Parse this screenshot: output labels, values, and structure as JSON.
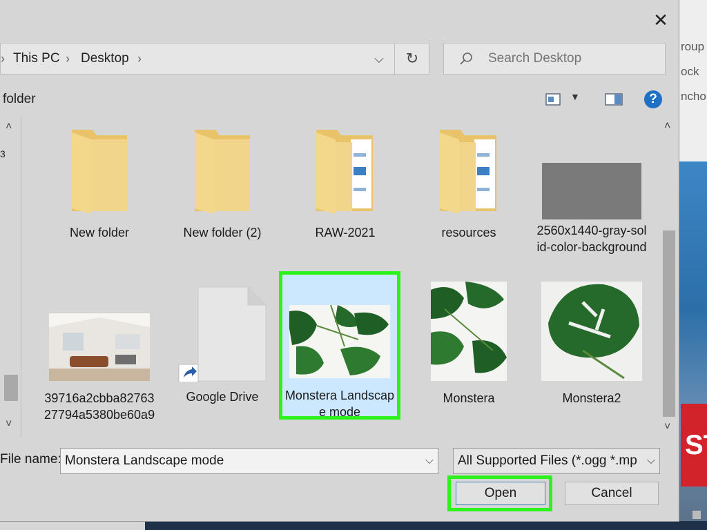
{
  "background_app": {
    "right_texts": [
      "roup",
      "ock",
      "ncho"
    ]
  },
  "dialog": {
    "address": {
      "crumbs": [
        "This PC",
        "Desktop"
      ],
      "separator": "›"
    },
    "search": {
      "placeholder": "Search Desktop"
    },
    "toolbar": {
      "new_folder_label": "folder",
      "help_label": "?"
    },
    "files": [
      {
        "name": "New folder",
        "type": "folder"
      },
      {
        "name": "New folder (2)",
        "type": "folder"
      },
      {
        "name": "RAW-2021",
        "type": "folder-with-docs"
      },
      {
        "name": "resources",
        "type": "folder-with-docs"
      },
      {
        "name": "2560x1440-gray-solid-color-background",
        "type": "gray-image"
      },
      {
        "name": "39716a2cbba8276327794a5380be60a9",
        "type": "room-photo"
      },
      {
        "name": "Google Drive",
        "type": "shortcut"
      },
      {
        "name": "Monstera Landscape mode",
        "type": "monstera-landscape",
        "selected": true
      },
      {
        "name": "Monstera",
        "type": "monstera"
      },
      {
        "name": "Monstera2",
        "type": "monstera2"
      }
    ],
    "file_name": {
      "label": "File name:",
      "value": "Monstera Landscape mode"
    },
    "file_type": {
      "value": "All Supported Files (*.ogg *.mp"
    },
    "buttons": {
      "open": "Open",
      "cancel": "Cancel"
    },
    "colors": {
      "highlight": "#2ef21d",
      "selection": "#cce8ff",
      "folder": "#f0d58a"
    }
  }
}
